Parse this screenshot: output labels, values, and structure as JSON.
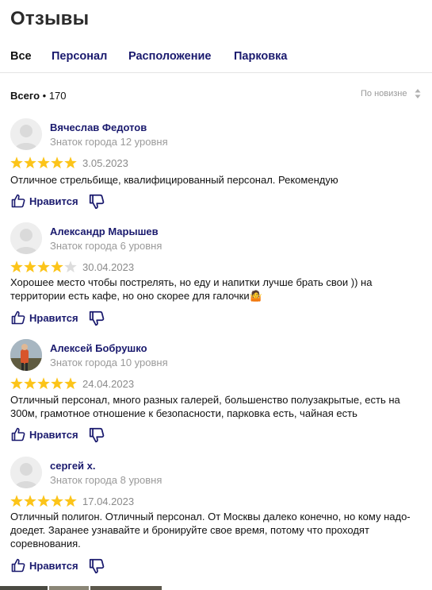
{
  "page": {
    "title": "Отзывы"
  },
  "tabs": [
    {
      "label": "Все",
      "active": true
    },
    {
      "label": "Персонал",
      "active": false
    },
    {
      "label": "Расположение",
      "active": false
    },
    {
      "label": "Парковка",
      "active": false
    }
  ],
  "summary": {
    "total_label": "Всего",
    "total_count": "170"
  },
  "sort": {
    "label": "По новизне",
    "icon": "sort-updown-icon"
  },
  "colors": {
    "link": "#1a1a6e",
    "star": "#fcc419",
    "star_empty": "#dddddd",
    "muted": "#9a9a9a"
  },
  "reviews": [
    {
      "author": "Вячеслав Федотов",
      "level": "Знаток города 12 уровня",
      "rating": 5,
      "date": "3.05.2023",
      "text": "Отличное стрельбище, квалифицированный персонал. Рекомендую",
      "like_label": "Нравится"
    },
    {
      "author": "Александр Марышев",
      "level": "Знаток города 6 уровня",
      "rating": 4,
      "date": "30.04.2023",
      "text": "Хорошее место чтобы пострелять, но еду и напитки лучше брать свои )) на территории есть кафе, но оно скорее для галочки🤷",
      "like_label": "Нравится"
    },
    {
      "author": "Алексей Бобрушко",
      "level": "Знаток города 10 уровня",
      "rating": 5,
      "date": "24.04.2023",
      "text": "Отличный персонал, много разных галерей, большенство полузакрытые, есть на 300м, грамотное отношение к безопасности, парковка есть, чайная есть",
      "like_label": "Нравится"
    },
    {
      "author": "сергей х.",
      "level": "Знаток города 8 уровня",
      "rating": 5,
      "date": "17.04.2023",
      "text": "Отличный полигон. Отличный персонал. От Москвы далеко конечно, но кому надо- доедет. Заранее узнавайте и бронируйте свое время, потому что проходят соревнования.",
      "like_label": "Нравится"
    }
  ]
}
